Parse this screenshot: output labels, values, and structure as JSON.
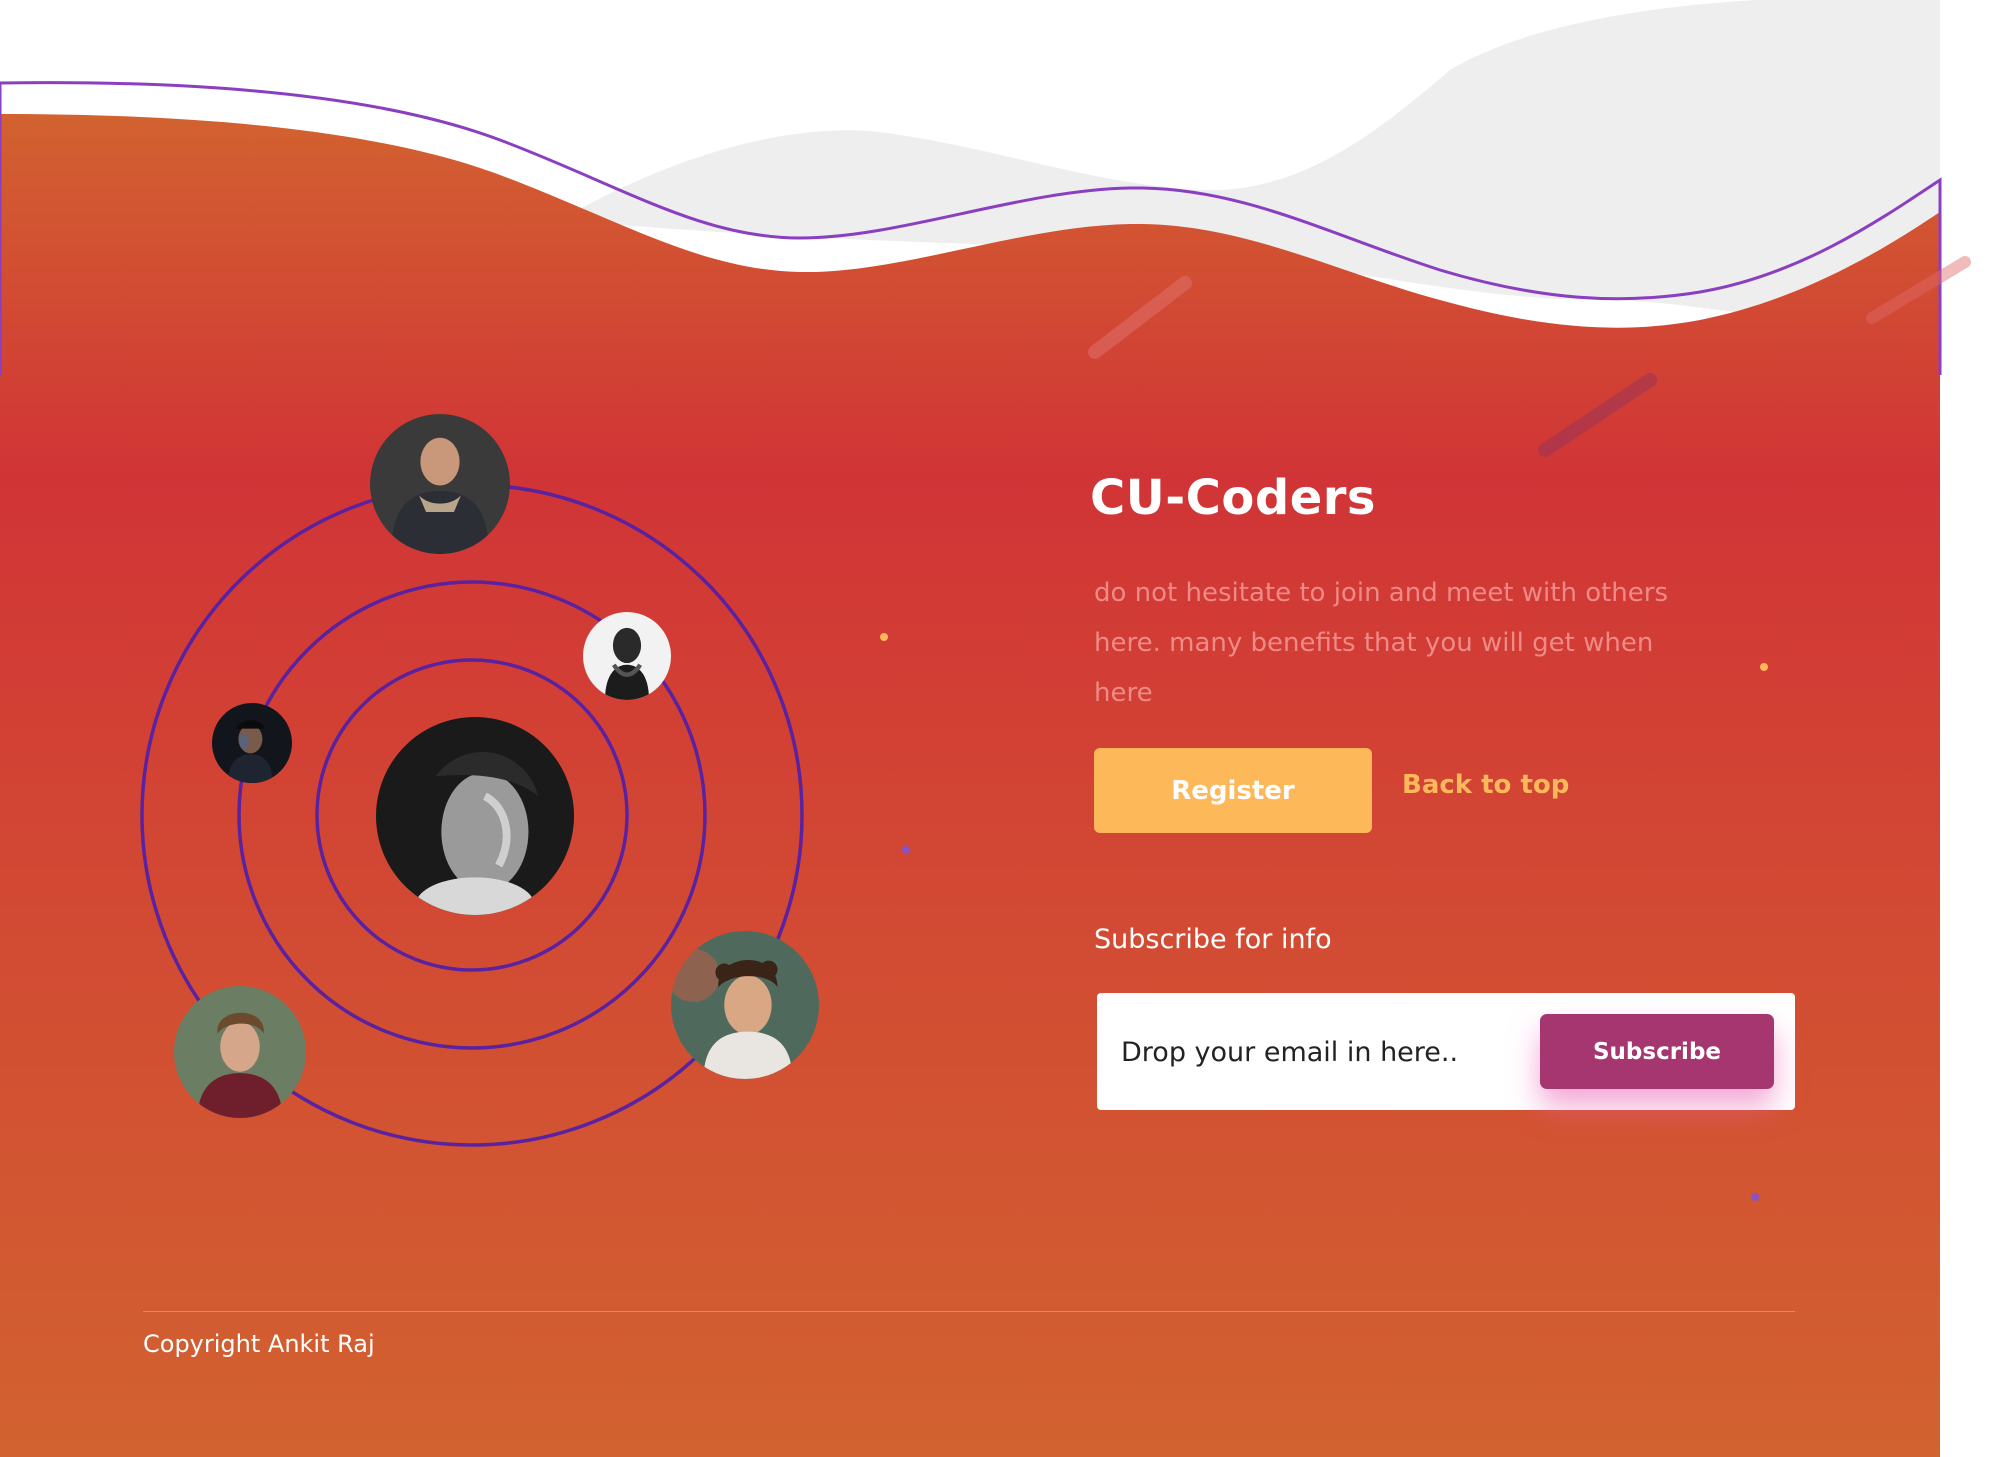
{
  "brand": {
    "title": "CU-Coders",
    "tagline": "do not hesitate to join and meet with others here. many benefits that you will get when here"
  },
  "actions": {
    "register_label": "Register",
    "back_to_top_label": "Back to top"
  },
  "subscribe": {
    "heading": "Subscribe for info",
    "email_placeholder": "Drop your email in here..",
    "button_label": "Subscribe"
  },
  "footer": {
    "copyright": "Copyright Ankit Raj"
  },
  "colors": {
    "gradient_top": "#d26230",
    "gradient_mid": "#d13436",
    "gradient_bottom": "#d26230",
    "orbit_ring": "#5a22a0",
    "accent_yellow": "#fdb85a",
    "subscribe_purple": "#a6366f"
  },
  "icons": {
    "avatars": [
      "person-photo",
      "person-photo",
      "person-photo",
      "person-photo",
      "person-photo",
      "person-photo"
    ]
  }
}
